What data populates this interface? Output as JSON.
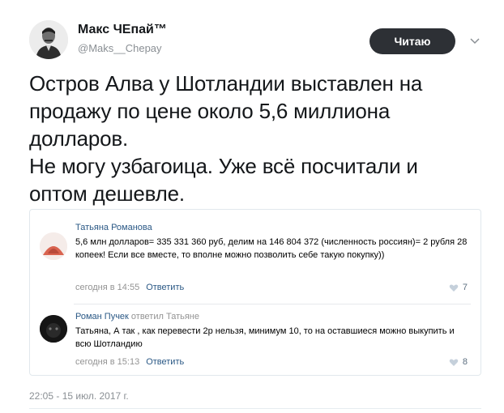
{
  "author": {
    "name": "Макс ЧЕпай™",
    "handle": "@Maks__Chepay"
  },
  "follow_button": {
    "label": "Читаю"
  },
  "tweet": {
    "text": "Остров Алва у Шотландии выставлен на\nпродажу по цене около 5,6 миллиона\nдолларов.\nНе могу узбагоица. Уже всё посчитали и\nоптом дешевле."
  },
  "embedded_comments": [
    {
      "author": "Татьяна Романова",
      "text": "5,6 млн долларов= 335 331 360 руб, делим на 146 804 372 (численность россиян)= 2 рубля 28 копеек! Если все вместе, то вполне можно позволить себе такую покупку))",
      "time": "сегодня в 14:55",
      "reply_label": "Ответить",
      "likes": "7"
    },
    {
      "author": "Роман Пучек",
      "reply_to": "ответил Татьяне",
      "text": "Татьяна, А так , как перевести 2р нельзя, минимум 10, то на оставшиеся можно выкупить и всю Шотландию",
      "time": "сегодня в 15:13",
      "reply_label": "Ответить",
      "likes": "8"
    }
  ],
  "timestamp": "22:05 - 15 июл. 2017 г.",
  "colors": {
    "button_bg": "#2d3035",
    "link": "#2a5885",
    "muted": "#939393"
  },
  "icons": {
    "chevron": "chevron-down-icon",
    "like": "heart-icon"
  }
}
